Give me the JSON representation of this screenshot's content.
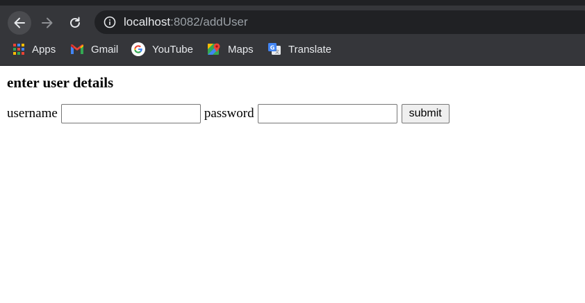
{
  "browser": {
    "url_host": "localhost",
    "url_rest": ":8082/addUser",
    "bookmarks": [
      {
        "label": "Apps",
        "icon": "apps-grid-icon"
      },
      {
        "label": "Gmail",
        "icon": "gmail-icon"
      },
      {
        "label": "YouTube",
        "icon": "google-icon"
      },
      {
        "label": "Maps",
        "icon": "maps-icon"
      },
      {
        "label": "Translate",
        "icon": "translate-icon"
      }
    ],
    "colors": {
      "toolbar_bg": "#35363a",
      "omnibox_bg": "#202124",
      "text": "#e8eaed",
      "muted_text": "#9aa0a6"
    }
  },
  "page": {
    "heading": "enter user details",
    "form": {
      "username_label": "username",
      "username_value": "",
      "password_label": "password",
      "password_value": "",
      "submit_label": "submit"
    }
  }
}
